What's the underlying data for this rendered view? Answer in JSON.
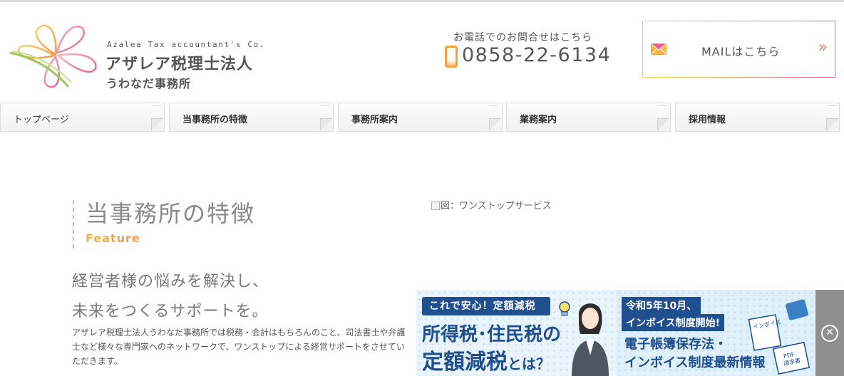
{
  "logo": {
    "en": "Azalea Tax accountant's Co.",
    "ja_line1": "アザレア税理士法人",
    "ja_line2": "うわなだ事務所"
  },
  "contact": {
    "phone_label": "お電話でのお問合せはこちら",
    "phone_number": "0858-22-6134",
    "mail_label": "MAILはこちら",
    "mail_arrow": "»"
  },
  "nav": {
    "items": [
      {
        "label": "トップページ"
      },
      {
        "label": "当事務所の特徴"
      },
      {
        "label": "事務所案内"
      },
      {
        "label": "業務案内"
      },
      {
        "label": "採用情報"
      }
    ]
  },
  "feature": {
    "title_ja": "当事務所の特徴",
    "title_en": "Feature",
    "lead_line1": "経営者様の悩みを解決し、",
    "lead_line2": "未来をつくるサポートを。",
    "body": "アザレア税理士法人うわなだ事務所では税務・会計はもちろんのこと、司法書士や弁護士など様々な専門家へのネットワークで、ワンストップによる経営サポートをさせていただきます。",
    "image_alt": "図：ワンストップサービス"
  },
  "ad": {
    "pill": "これで安心！定額減税",
    "headline1": "所得税･住民税の",
    "headline2_main": "定額減税",
    "headline2_tail": "とは？",
    "tag1": "令和5年10月、",
    "tag2": "インボイス制度開始!",
    "right_line1": "電子帳簿保存法・",
    "right_line2": "インボイス制度最新情報",
    "doc_label1": "インボイス",
    "doc_label2": "PDF",
    "doc_label3": "請求書",
    "close_glyph": "✕"
  },
  "colors": {
    "accent_orange": "#f2a23a",
    "accent_pink": "#e7608a",
    "ad_navy": "#1f4f8e"
  }
}
